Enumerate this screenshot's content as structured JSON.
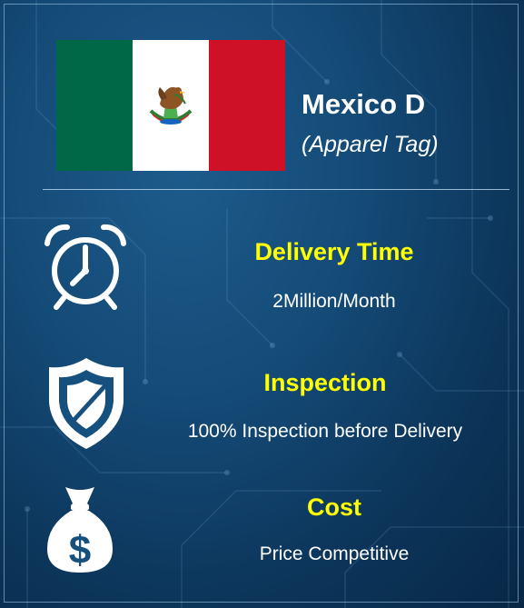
{
  "header": {
    "title": "Mexico D",
    "subtitle": "(Apparel Tag)"
  },
  "features": [
    {
      "icon": "alarm-clock-icon",
      "heading": "Delivery Time",
      "detail": "2Million/Month"
    },
    {
      "icon": "shield-icon",
      "heading": "Inspection",
      "detail": "100% Inspection before Delivery"
    },
    {
      "icon": "money-bag-icon",
      "heading": "Cost",
      "detail": "Price Competitive"
    }
  ],
  "colors": {
    "heading": "#ffff00",
    "text": "#ffffff",
    "background": "#144a76",
    "flag_green": "#006847",
    "flag_white": "#ffffff",
    "flag_red": "#ce1126"
  }
}
